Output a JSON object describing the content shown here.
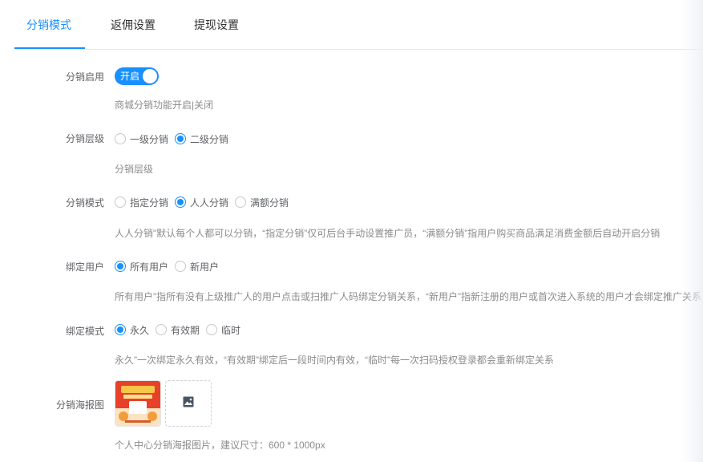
{
  "tabs": [
    {
      "label": "分销模式",
      "active": true
    },
    {
      "label": "返佣设置",
      "active": false
    },
    {
      "label": "提现设置",
      "active": false
    }
  ],
  "form": {
    "enable": {
      "label": "分销启用",
      "switch_text": "开启",
      "on": true,
      "hint": "商城分销功能开启|关闭"
    },
    "level": {
      "label": "分销层级",
      "options": [
        "一级分销",
        "二级分销"
      ],
      "selected": "二级分销",
      "hint": "分销层级"
    },
    "mode": {
      "label": "分销模式",
      "options": [
        "指定分销",
        "人人分销",
        "满额分销"
      ],
      "selected": "人人分销",
      "hint": "人人分销\"默认每个人都可以分销，“指定分销”仅可后台手动设置推广员，“满额分销”指用户购买商品满足消费金额后自动开启分销"
    },
    "bind_user": {
      "label": "绑定用户",
      "options": [
        "所有用户",
        "新用户"
      ],
      "selected": "所有用户",
      "hint": "所有用户”指所有没有上级推广人的用户点击或扫推广人码绑定分销关系，“新用户”指新注册的用户或首次进入系统的用户才会绑定推广关系"
    },
    "bind_mode": {
      "label": "绑定模式",
      "options": [
        "永久",
        "有效期",
        "临时"
      ],
      "selected": "永久",
      "hint": "永久”一次绑定永久有效，“有效期”绑定后一段时间内有效，“临时”每一次扫码授权登录都会重新绑定关系"
    },
    "poster": {
      "label": "分销海报图",
      "image_icon": "image-icon",
      "hint": "个人中心分销海报图片，建议尺寸：600 * 1000px"
    }
  },
  "colors": {
    "primary": "#1890ff",
    "label": "#606266",
    "hint": "#8c8c8c",
    "divider": "#e4e7ed"
  }
}
